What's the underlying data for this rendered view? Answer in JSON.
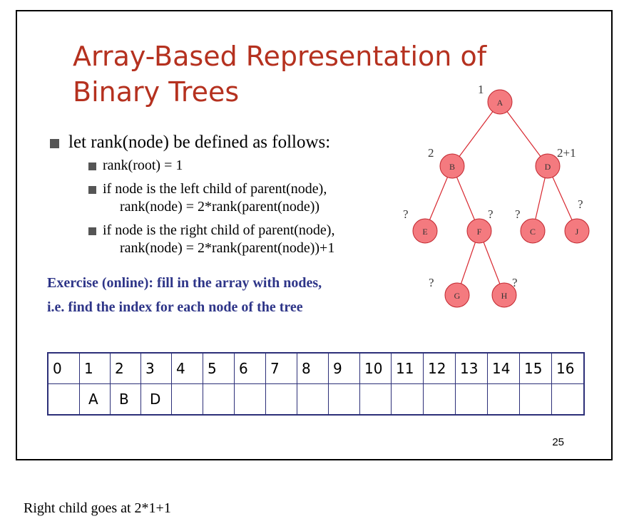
{
  "slide": {
    "title_line1": "Array-Based Representation of",
    "title_line2": "Binary Trees",
    "bullet_main": "let rank(node) be defined as follows:",
    "sub_bullets": [
      {
        "line1": "rank(root) = 1",
        "line2": ""
      },
      {
        "line1": "if node is the left child of parent(node),",
        "line2": "rank(node) = 2*rank(parent(node))"
      },
      {
        "line1": "if node is the right child of parent(node),",
        "line2": "rank(node) = 2*rank(parent(node))+1"
      }
    ],
    "exercise_line1": "Exercise (online): fill in the array with nodes,",
    "exercise_line2": "i.e. find the index for each node of the tree",
    "page_number": "25"
  },
  "tree": {
    "nodes": {
      "A": "A",
      "B": "B",
      "D": "D",
      "E": "E",
      "F": "F",
      "C": "C",
      "J": "J",
      "G": "G",
      "H": "H"
    },
    "ranks": {
      "A": "1",
      "B": "2",
      "D": "2+1",
      "E": "?",
      "F": "?",
      "C": "?",
      "J": "?",
      "G": "?",
      "H": "?"
    }
  },
  "array": {
    "indices": [
      "0",
      "1",
      "2",
      "3",
      "4",
      "5",
      "6",
      "7",
      "8",
      "9",
      "10",
      "11",
      "12",
      "13",
      "14",
      "15",
      "16"
    ],
    "values": [
      "",
      "A",
      "B",
      "D",
      "",
      "",
      "",
      "",
      "",
      "",
      "",
      "",
      "",
      "",
      "",
      "",
      ""
    ]
  },
  "note": "Right child goes at 2*1+1",
  "colors": {
    "title": "#b5311f",
    "exercise": "#2e3588",
    "node_fill": "#f47a7f",
    "edge": "#d8272f",
    "table_border": "#2c2f78"
  }
}
